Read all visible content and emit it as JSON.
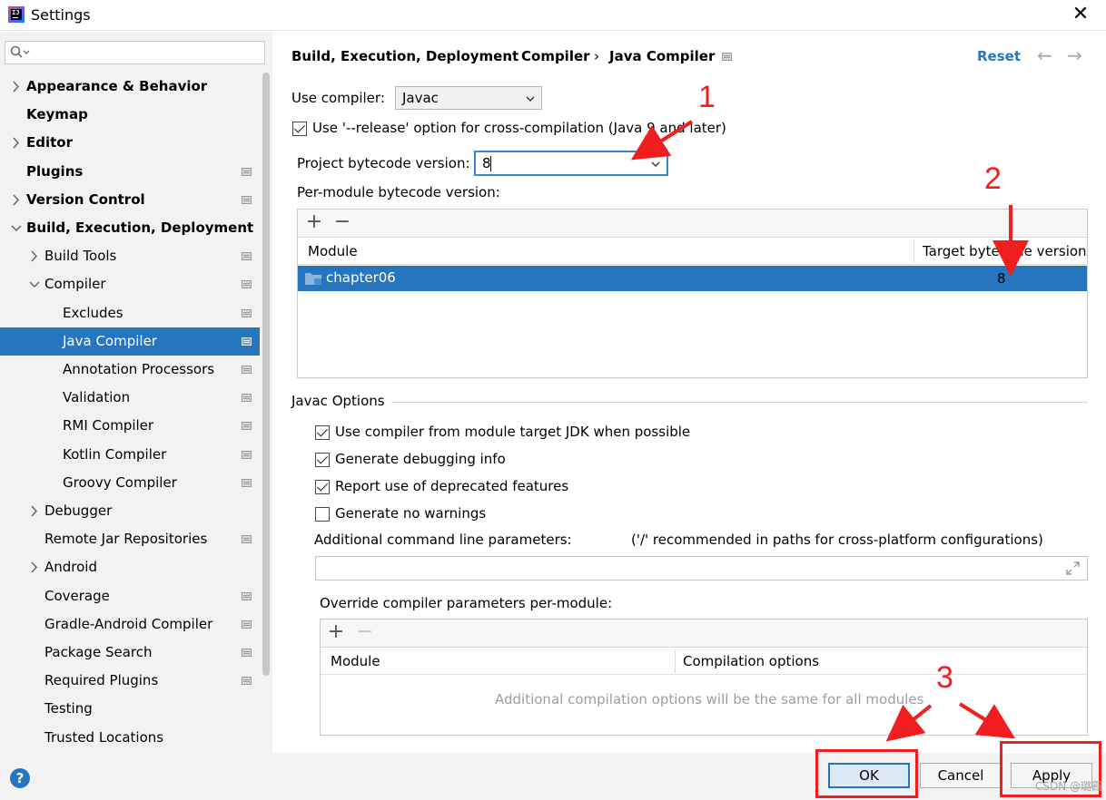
{
  "window": {
    "title": "Settings",
    "close_glyph": "✕"
  },
  "app_icon_text": "IJ",
  "search": {
    "placeholder": "",
    "icon": "search-icon"
  },
  "sidebar": {
    "items": [
      {
        "label": "Appearance & Behavior",
        "bold": true,
        "chevron": "right",
        "level": 0,
        "proj": false
      },
      {
        "label": "Keymap",
        "bold": true,
        "chevron": "none",
        "level": 0,
        "proj": false
      },
      {
        "label": "Editor",
        "bold": true,
        "chevron": "right",
        "level": 0,
        "proj": false
      },
      {
        "label": "Plugins",
        "bold": true,
        "chevron": "none",
        "level": 0,
        "proj": true
      },
      {
        "label": "Version Control",
        "bold": true,
        "chevron": "right",
        "level": 0,
        "proj": true
      },
      {
        "label": "Build, Execution, Deployment",
        "bold": true,
        "chevron": "down",
        "level": 0,
        "proj": false
      },
      {
        "label": "Build Tools",
        "bold": false,
        "chevron": "right",
        "level": 1,
        "proj": true
      },
      {
        "label": "Compiler",
        "bold": false,
        "chevron": "down",
        "level": 1,
        "proj": true
      },
      {
        "label": "Excludes",
        "bold": false,
        "chevron": "none",
        "level": 2,
        "proj": true
      },
      {
        "label": "Java Compiler",
        "bold": false,
        "chevron": "none",
        "level": 2,
        "proj": true,
        "selected": true
      },
      {
        "label": "Annotation Processors",
        "bold": false,
        "chevron": "none",
        "level": 2,
        "proj": true
      },
      {
        "label": "Validation",
        "bold": false,
        "chevron": "none",
        "level": 2,
        "proj": true
      },
      {
        "label": "RMI Compiler",
        "bold": false,
        "chevron": "none",
        "level": 2,
        "proj": true
      },
      {
        "label": "Kotlin Compiler",
        "bold": false,
        "chevron": "none",
        "level": 2,
        "proj": true
      },
      {
        "label": "Groovy Compiler",
        "bold": false,
        "chevron": "none",
        "level": 2,
        "proj": true
      },
      {
        "label": "Debugger",
        "bold": false,
        "chevron": "right",
        "level": 1,
        "proj": false
      },
      {
        "label": "Remote Jar Repositories",
        "bold": false,
        "chevron": "none",
        "level": 1,
        "proj": true
      },
      {
        "label": "Android",
        "bold": false,
        "chevron": "right",
        "level": 1,
        "proj": false
      },
      {
        "label": "Coverage",
        "bold": false,
        "chevron": "none",
        "level": 1,
        "proj": true
      },
      {
        "label": "Gradle-Android Compiler",
        "bold": false,
        "chevron": "none",
        "level": 1,
        "proj": true
      },
      {
        "label": "Package Search",
        "bold": false,
        "chevron": "none",
        "level": 1,
        "proj": true
      },
      {
        "label": "Required Plugins",
        "bold": false,
        "chevron": "none",
        "level": 1,
        "proj": true
      },
      {
        "label": "Testing",
        "bold": false,
        "chevron": "none",
        "level": 1,
        "proj": false
      },
      {
        "label": "Trusted Locations",
        "bold": false,
        "chevron": "none",
        "level": 1,
        "proj": false
      }
    ]
  },
  "breadcrumb": {
    "items": [
      "Build, Execution, Deployment",
      "Compiler",
      "Java Compiler"
    ],
    "separator": "›",
    "reset": "Reset",
    "back_glyph": "←",
    "forward_glyph": "→"
  },
  "compiler": {
    "use_compiler_label": "Use compiler:",
    "use_compiler_value": "Javac",
    "release_option_label": "Use '--release' option for cross-compilation (Java 9 and later)",
    "release_option_checked": true,
    "bytecode_label": "Project bytecode version:",
    "bytecode_value": "8",
    "per_module_label": "Per-module bytecode version:"
  },
  "module_table": {
    "add_glyph": "+",
    "remove_glyph": "−",
    "col_module": "Module",
    "col_target": "Target bytecode version",
    "rows": [
      {
        "module": "chapter06",
        "target": "8"
      }
    ]
  },
  "javac": {
    "section_title": "Javac Options",
    "options": [
      {
        "label": "Use compiler from module target JDK when possible",
        "checked": true
      },
      {
        "label": "Generate debugging info",
        "checked": true
      },
      {
        "label": "Report use of deprecated features",
        "checked": true
      },
      {
        "label": "Generate no warnings",
        "checked": false
      }
    ],
    "additional_label": "Additional command line parameters:",
    "additional_hint": "('/' recommended in paths for cross-platform configurations)",
    "additional_value": "",
    "override_label": "Override compiler parameters per-module:",
    "override_col_module": "Module",
    "override_col_options": "Compilation options",
    "override_empty": "Additional compilation options will be the same for all modules"
  },
  "buttons": {
    "help": "?",
    "ok": "OK",
    "cancel": "Cancel",
    "apply": "Apply"
  },
  "annotations": {
    "n1": "1",
    "n2": "2",
    "n3": "3"
  },
  "watermark": "CSDN @璐霞",
  "colors": {
    "accent": "#2675bf",
    "annotation": "#f01e1e",
    "sidebar_bg": "#f2f2f2"
  }
}
